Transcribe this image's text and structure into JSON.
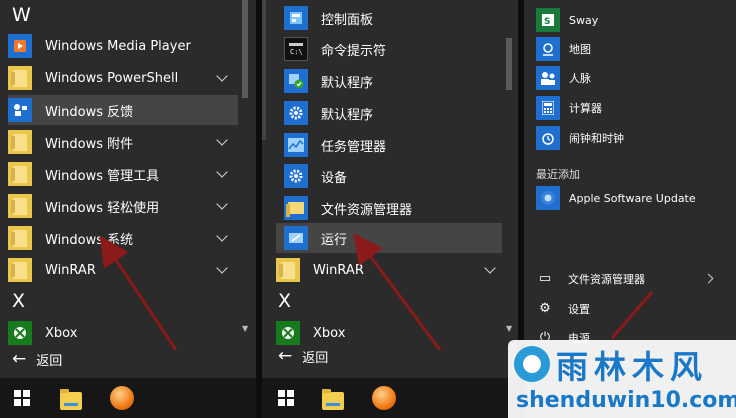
{
  "left_menu": {
    "letter_w": "W",
    "items": [
      {
        "label": "Windows Media Player",
        "icon": "media-player-icon"
      },
      {
        "label": "Windows PowerShell",
        "icon": "folder-icon"
      },
      {
        "label": "Windows 反馈",
        "icon": "feedback-icon"
      },
      {
        "label": "Windows 附件",
        "icon": "folder-icon"
      },
      {
        "label": "Windows 管理工具",
        "icon": "folder-icon"
      },
      {
        "label": "Windows 轻松使用",
        "icon": "folder-icon"
      },
      {
        "label": "Windows 系统",
        "icon": "folder-icon"
      },
      {
        "label": "WinRAR",
        "icon": "folder-icon"
      }
    ],
    "letter_x": "X",
    "xbox": "Xbox",
    "back": "返回"
  },
  "middle_menu": {
    "items": [
      {
        "label": "控制面板",
        "icon": "control-panel-icon"
      },
      {
        "label": "命令提示符",
        "icon": "command-prompt-icon"
      },
      {
        "label": "默认程序",
        "icon": "default-programs-icon"
      },
      {
        "label": "默认程序",
        "icon": "gear-icon"
      },
      {
        "label": "任务管理器",
        "icon": "task-manager-icon"
      },
      {
        "label": "设备",
        "icon": "gear-icon"
      },
      {
        "label": "文件资源管理器",
        "icon": "folder-icon"
      },
      {
        "label": "运行",
        "icon": "run-icon"
      }
    ],
    "winrar": "WinRAR",
    "letter_x": "X",
    "xbox": "Xbox",
    "back": "返回"
  },
  "right_menu": {
    "items": [
      {
        "label": "Sway",
        "icon": "sway-icon"
      },
      {
        "label": "地图",
        "icon": "map-icon"
      },
      {
        "label": "人脉",
        "icon": "people-icon"
      },
      {
        "label": "计算器",
        "icon": "calculator-icon"
      },
      {
        "label": "闹钟和时钟",
        "icon": "alarm-clock-icon"
      }
    ],
    "recent_header": "最近添加",
    "recent_app": "Apple Software Update",
    "file_explorer": "文件资源管理器",
    "settings": "设置",
    "power": "电源"
  },
  "watermark": {
    "cn": "雨林木风",
    "url": "shenduwin10.com"
  },
  "colors": {
    "panel_bg": "#2b2b2b",
    "highlight": "#454545",
    "tile_blue": "#1f6fd0",
    "arrow_red": "#8b1a1a"
  }
}
